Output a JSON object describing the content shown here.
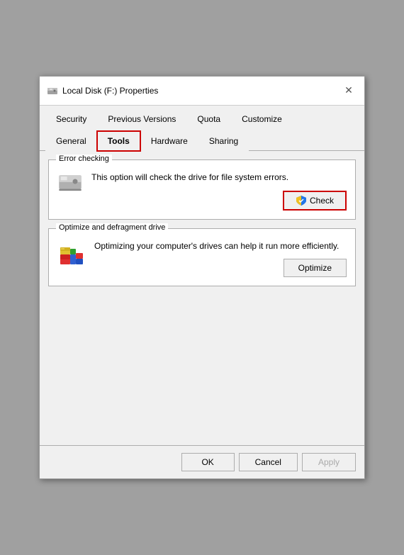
{
  "window": {
    "title": "Local Disk (F:) Properties",
    "close_label": "✕"
  },
  "tabs": {
    "row1": [
      {
        "id": "security",
        "label": "Security"
      },
      {
        "id": "previous-versions",
        "label": "Previous Versions"
      },
      {
        "id": "quota",
        "label": "Quota"
      },
      {
        "id": "customize",
        "label": "Customize"
      }
    ],
    "row2": [
      {
        "id": "general",
        "label": "General"
      },
      {
        "id": "tools",
        "label": "Tools",
        "active": true
      },
      {
        "id": "hardware",
        "label": "Hardware"
      },
      {
        "id": "sharing",
        "label": "Sharing"
      }
    ]
  },
  "error_checking": {
    "group_label": "Error checking",
    "description": "This option will check the drive for file system errors.",
    "button_label": "Check"
  },
  "optimize": {
    "group_label": "Optimize and defragment drive",
    "description": "Optimizing your computer's drives can help it run more efficiently.",
    "button_label": "Optimize"
  },
  "bottom_buttons": {
    "ok": "OK",
    "cancel": "Cancel",
    "apply": "Apply"
  }
}
